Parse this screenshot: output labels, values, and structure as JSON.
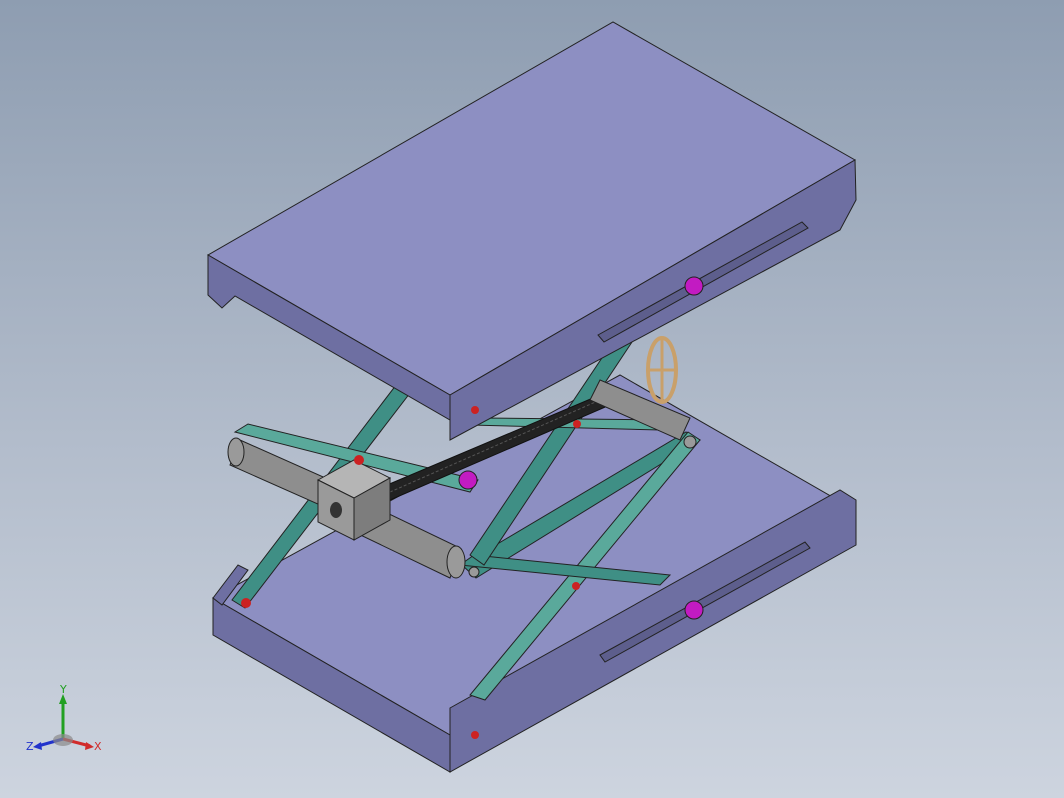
{
  "viewport": {
    "background_top": "#8e9db1",
    "background_bottom": "#cdd4df"
  },
  "colors": {
    "plate": "#8d8fc2",
    "plate_side": "#6e6fa2",
    "plate_dark": "#5d5e8c",
    "scissor_arm": "#3f8f85",
    "scissor_arm_light": "#5aa99b",
    "screw_body": "#8e8e8e",
    "pin_red": "#cc2222",
    "knob_magenta": "#c21bc2",
    "handwheel": "#c9a06a"
  },
  "model": {
    "parts": [
      {
        "name": "top-plate"
      },
      {
        "name": "bottom-plate"
      },
      {
        "name": "scissor-arms"
      },
      {
        "name": "lead-screw"
      },
      {
        "name": "nut-block"
      },
      {
        "name": "hand-wheel"
      },
      {
        "name": "adjust-knob"
      }
    ]
  },
  "triad": {
    "x_label": "X",
    "y_label": "Y",
    "z_label": "Z",
    "x_color": "#d12b2b",
    "y_color": "#22a022",
    "z_color": "#2233cc"
  }
}
